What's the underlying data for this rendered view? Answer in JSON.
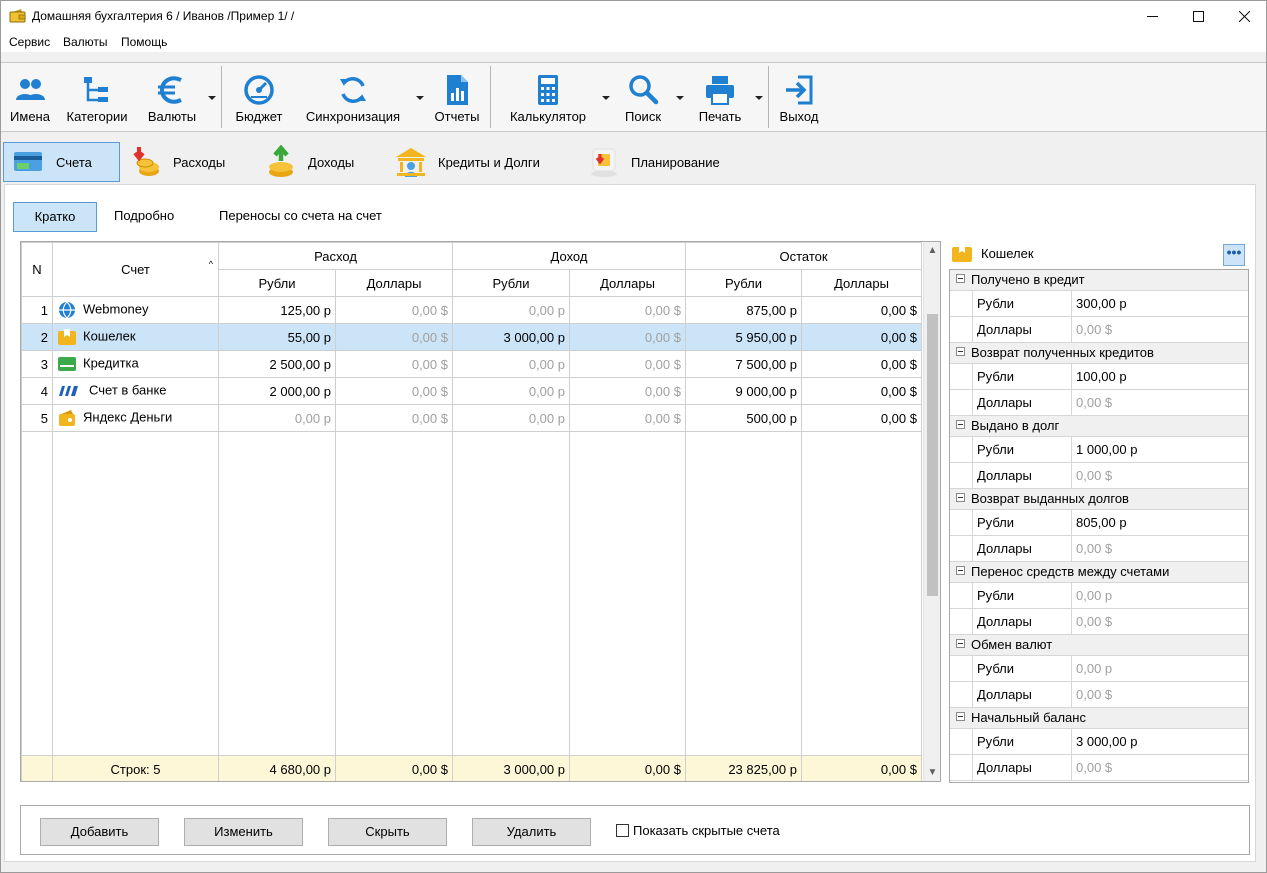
{
  "window": {
    "title": "Домашняя бухгалтерия 6  / Иванов /Пример 1/ /",
    "minimize": "—",
    "maximize": "☐",
    "close": "✕"
  },
  "menu": [
    "Сервис",
    "Валюты",
    "Помощь"
  ],
  "toolbar": {
    "names": "Имена",
    "categories": "Категории",
    "currencies": "Валюты",
    "budget": "Бюджет",
    "sync": "Синхронизация",
    "reports": "Отчеты",
    "calculator": "Калькулятор",
    "search": "Поиск",
    "print": "Печать",
    "exit": "Выход"
  },
  "modules": {
    "accounts": "Счета",
    "expenses": "Расходы",
    "income": "Доходы",
    "credits": "Кредиты и Долги",
    "planning": "Планирование"
  },
  "subtabs": [
    "Кратко",
    "Подробно",
    "Переносы со счета на счет"
  ],
  "table": {
    "col_n": "N",
    "col_account": "Счет",
    "group_expense": "Расход",
    "group_income": "Доход",
    "group_balance": "Остаток",
    "rub": "Рубли",
    "usd": "Доллары",
    "rows": [
      {
        "n": "1",
        "name": "Webmoney",
        "exp_rub": "125,00 р",
        "exp_usd": "0,00 $",
        "inc_rub": "0,00 р",
        "inc_usd": "0,00 $",
        "bal_rub": "875,00 р",
        "bal_usd": "0,00 $"
      },
      {
        "n": "2",
        "name": "Кошелек",
        "exp_rub": "55,00 р",
        "exp_usd": "0,00 $",
        "inc_rub": "3 000,00 р",
        "inc_usd": "0,00 $",
        "bal_rub": "5 950,00 р",
        "bal_usd": "0,00 $"
      },
      {
        "n": "3",
        "name": "Кредитка",
        "exp_rub": "2 500,00 р",
        "exp_usd": "0,00 $",
        "inc_rub": "0,00 р",
        "inc_usd": "0,00 $",
        "bal_rub": "7 500,00 р",
        "bal_usd": "0,00 $"
      },
      {
        "n": "4",
        "name": "Счет в банке",
        "exp_rub": "2 000,00 р",
        "exp_usd": "0,00 $",
        "inc_rub": "0,00 р",
        "inc_usd": "0,00 $",
        "bal_rub": "9 000,00 р",
        "bal_usd": "0,00 $"
      },
      {
        "n": "5",
        "name": "Яндекс Деньги",
        "exp_rub": "0,00 р",
        "exp_usd": "0,00 $",
        "inc_rub": "0,00 р",
        "inc_usd": "0,00 $",
        "bal_rub": "500,00 р",
        "bal_usd": "0,00 $"
      }
    ],
    "footer": {
      "rows_count": "Строк: 5",
      "exp_rub": "4 680,00 р",
      "exp_usd": "0,00 $",
      "inc_rub": "3 000,00 р",
      "inc_usd": "0,00 $",
      "bal_rub": "23 825,00 р",
      "bal_usd": "0,00 $"
    }
  },
  "details": {
    "title": "Кошелек",
    "more": "•••",
    "groups": [
      {
        "name": "Получено в кредит",
        "rub": "300,00 р",
        "usd": "0,00 $"
      },
      {
        "name": "Возврат полученных кредитов",
        "rub": "100,00 р",
        "usd": "0,00 $"
      },
      {
        "name": "Выдано в долг",
        "rub": "1 000,00 р",
        "usd": "0,00 $"
      },
      {
        "name": "Возврат выданных долгов",
        "rub": "805,00 р",
        "usd": "0,00 $"
      },
      {
        "name": "Перенос средств между счетами",
        "rub": "0,00 р",
        "usd": "0,00 $"
      },
      {
        "name": "Обмен валют",
        "rub": "0,00 р",
        "usd": "0,00 $"
      },
      {
        "name": "Начальный баланс",
        "rub": "3 000,00 р",
        "usd": "0,00 $"
      }
    ],
    "rub_label": "Рубли",
    "usd_label": "Доллары"
  },
  "buttons": {
    "add": "Добавить",
    "edit": "Изменить",
    "hide": "Скрыть",
    "delete": "Удалить",
    "show_hidden": "Показать скрытые счета"
  },
  "colors": {
    "accent": "#1a7fd4",
    "selection": "#cce4f7",
    "footer": "#fdf7d8"
  }
}
